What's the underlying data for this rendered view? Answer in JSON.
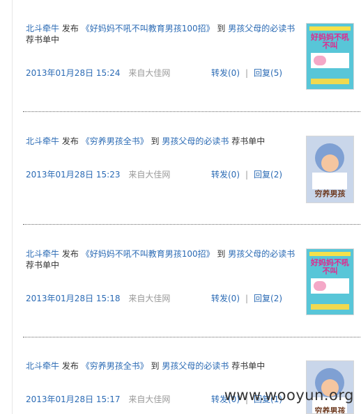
{
  "feed": [
    {
      "user": "北斗牵牛",
      "action": "发布",
      "book_title": "《好妈妈不吼不叫教育男孩100招》",
      "to": "到",
      "list_name": "男孩父母的必读书",
      "suffix": "荐书单中",
      "time": "2013年01月28日 15:24",
      "source": "来自大佳网",
      "forward": "转发(0)",
      "reply": "回复(5)",
      "cover_text": "好妈妈不吼不叫"
    },
    {
      "user": "北斗牵牛",
      "action": "发布",
      "book_title": "《穷养男孩全书》",
      "to": "到",
      "list_name": "男孩父母的必读书",
      "suffix": "荐书单中",
      "time": "2013年01月28日 15:23",
      "source": "来自大佳网",
      "forward": "转发(0)",
      "reply": "回复(2)",
      "cover_text": "穷养男孩"
    },
    {
      "user": "北斗牵牛",
      "action": "发布",
      "book_title": "《好妈妈不吼不叫教育男孩100招》",
      "to": "到",
      "list_name": "男孩父母的必读书",
      "suffix": "荐书单中",
      "time": "2013年01月28日 15:18",
      "source": "来自大佳网",
      "forward": "转发(0)",
      "reply": "回复(2)",
      "cover_text": "好妈妈不吼不叫"
    },
    {
      "user": "北斗牵牛",
      "action": "发布",
      "book_title": "《穷养男孩全书》",
      "to": "到",
      "list_name": "男孩父母的必读书",
      "suffix": "荐书单中",
      "time": "2013年01月28日 15:17",
      "source": "来自大佳网",
      "forward": "转发(0)",
      "reply": "回复(1)",
      "cover_text": "穷养男孩"
    }
  ],
  "separator": "|",
  "watermark": "www.wooyun.org",
  "colors": {
    "link": "#2a6ab4",
    "muted": "#999999",
    "text": "#333333"
  }
}
